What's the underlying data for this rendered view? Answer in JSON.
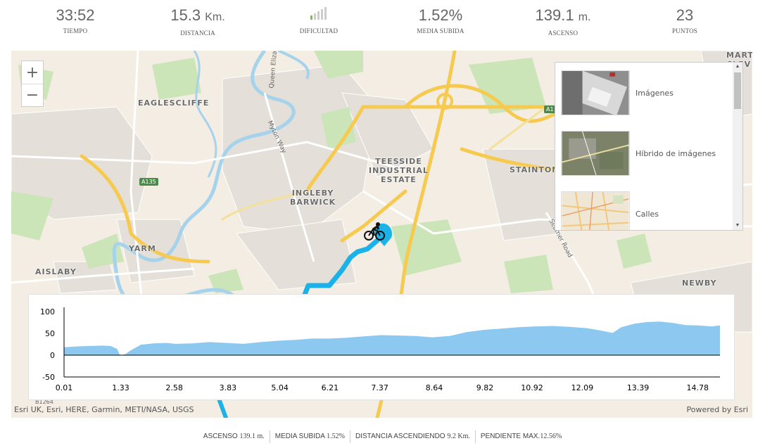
{
  "stats": [
    {
      "id": "tiempo",
      "value": "33:52",
      "unit": "",
      "label": "TIEMPO"
    },
    {
      "id": "distancia",
      "value": "15.3",
      "unit": "Km.",
      "label": "DISTANCIA"
    },
    {
      "id": "dificultad",
      "value": "",
      "unit": "",
      "label": "DIFICULTAD"
    },
    {
      "id": "media-subida",
      "value": "1.52%",
      "unit": "",
      "label": "MEDIA SUBIDA"
    },
    {
      "id": "ascenso",
      "value": "139.1",
      "unit": "m.",
      "label": "ASCENSO"
    },
    {
      "id": "puntos",
      "value": "23",
      "unit": "",
      "label": "PUNTOS"
    }
  ],
  "difficulty": {
    "level": 1,
    "max": 5,
    "active_color": "#7cc242",
    "inactive_color": "#cccccc"
  },
  "map": {
    "zoom_in": "+",
    "zoom_out": "−",
    "labels": {
      "eaglescliffe": "EAGLESCLIFFE",
      "yarm": "YARM",
      "aislaby": "AISLABY",
      "ingleby": "INGLEBY\nBARWICK",
      "teesside": "TEESSIDE\nINDUSTRIAL\nESTATE",
      "stainton": "STAINTON",
      "newby": "NEWBY",
      "marton": "MART\nCLEV"
    },
    "roads": {
      "myton": "Myton Way",
      "queen": "Queen Eliza",
      "seamer": "Seamer Road",
      "a135": "A135",
      "a1": "A1",
      "b1264": "B1264"
    },
    "gallery": [
      {
        "label": "Imágenes",
        "icon": "satellite-thumbnail"
      },
      {
        "label": "Híbrido de imágenes",
        "icon": "hybrid-thumbnail"
      },
      {
        "label": "Calles",
        "icon": "streets-thumbnail"
      }
    ],
    "attribution": "Esri UK, Esri, HERE, Garmin, METI/NASA, USGS",
    "powered_by": "Powered by Esri",
    "route_color": "#1ab2e8",
    "rider_icon": "cyclist-icon"
  },
  "chart_data": {
    "type": "area",
    "x_tick_labels": [
      "0.01",
      "1.33",
      "2.58",
      "3.83",
      "5.04",
      "6.21",
      "7.37",
      "8.64",
      "9.82",
      "10.92",
      "12.09",
      "13.39",
      "14.78"
    ],
    "y_tick_labels": [
      "100",
      "50",
      "0",
      "-50"
    ],
    "ylim": [
      -50,
      100
    ],
    "xlim": [
      0.01,
      15.3
    ],
    "fill_color": "#8cc8f0",
    "x": [
      0.01,
      0.3,
      0.6,
      0.9,
      1.1,
      1.25,
      1.3,
      1.36,
      1.45,
      1.55,
      1.8,
      2.1,
      2.4,
      2.6,
      3.0,
      3.4,
      3.8,
      4.2,
      4.6,
      5.0,
      5.4,
      5.8,
      6.2,
      6.6,
      7.0,
      7.4,
      7.8,
      8.2,
      8.6,
      9.0,
      9.4,
      9.8,
      10.2,
      10.6,
      11.0,
      11.4,
      11.8,
      12.2,
      12.5,
      12.8,
      13.0,
      13.3,
      13.6,
      13.9,
      14.2,
      14.5,
      14.8,
      15.1,
      15.3
    ],
    "y": [
      18,
      20,
      21,
      22,
      21,
      14,
      2,
      0,
      3,
      10,
      24,
      27,
      28,
      26,
      27,
      30,
      28,
      26,
      30,
      33,
      35,
      38,
      38,
      40,
      43,
      46,
      45,
      44,
      41,
      44,
      53,
      58,
      61,
      64,
      66,
      67,
      65,
      62,
      57,
      51,
      64,
      72,
      76,
      77,
      74,
      69,
      68,
      66,
      68
    ]
  },
  "footer": [
    {
      "id": "ascenso",
      "label": "ASCENSO",
      "value": "139.1 m."
    },
    {
      "id": "media-subida",
      "label": "MEDIA SUBIDA",
      "value": "1.52%"
    },
    {
      "id": "distancia-ascendiendo",
      "label": "DISTANCIA ASCENDIENDO",
      "value": "9.2 Km."
    },
    {
      "id": "pendiente-max",
      "label": "PENDIENTE MAX.",
      "value": "12.56%"
    }
  ]
}
